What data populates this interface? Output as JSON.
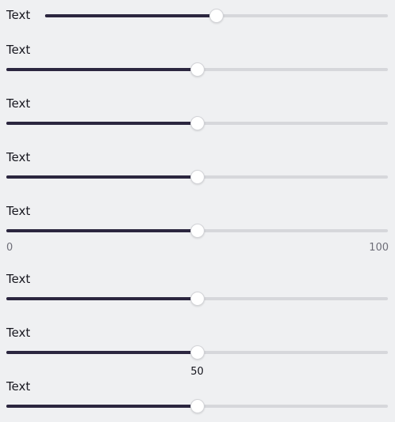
{
  "sliders": [
    {
      "label": "Text",
      "value": 50,
      "min": 0,
      "max": 100
    },
    {
      "label": "Text",
      "value": 50,
      "min": 0,
      "max": 100
    },
    {
      "label": "Text",
      "value": 50,
      "min": 0,
      "max": 100
    },
    {
      "label": "Text",
      "value": 50,
      "min": 0,
      "max": 100
    },
    {
      "label": "Text",
      "value": 50,
      "min": 0,
      "max": 100,
      "min_label": "0",
      "max_label": "100"
    },
    {
      "label": "Text",
      "value": 50,
      "min": 0,
      "max": 100
    },
    {
      "label": "Text",
      "value": 50,
      "min": 0,
      "max": 100,
      "value_label": "50"
    },
    {
      "label": "Text",
      "value": 50,
      "min": 0,
      "max": 100
    }
  ],
  "colors": {
    "background": "#eff0f2",
    "track": "#d6d7db",
    "fill": "#2b263f",
    "thumb": "#ffffff"
  }
}
